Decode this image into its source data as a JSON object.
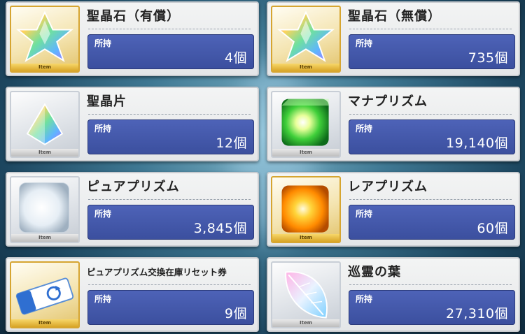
{
  "held_label": "所持",
  "tag_label": "Item",
  "items": [
    {
      "name": "聖晶石（有償）",
      "value": "4個",
      "icon": "saint-quartz-icon"
    },
    {
      "name": "聖晶石（無償）",
      "value": "735個",
      "icon": "saint-quartz-icon"
    },
    {
      "name": "聖晶片",
      "value": "12個",
      "icon": "quartz-fragment-icon"
    },
    {
      "name": "マナプリズム",
      "value": "19,140個",
      "icon": "mana-prism-icon"
    },
    {
      "name": "ピュアプリズム",
      "value": "3,845個",
      "icon": "pure-prism-icon"
    },
    {
      "name": "レアプリズム",
      "value": "60個",
      "icon": "rare-prism-icon"
    },
    {
      "name": "ピュアプリズム交換在庫リセット券",
      "value": "9個",
      "icon": "reset-ticket-icon"
    },
    {
      "name": "巡霊の葉",
      "value": "27,310個",
      "icon": "spirit-leaf-icon"
    }
  ]
}
